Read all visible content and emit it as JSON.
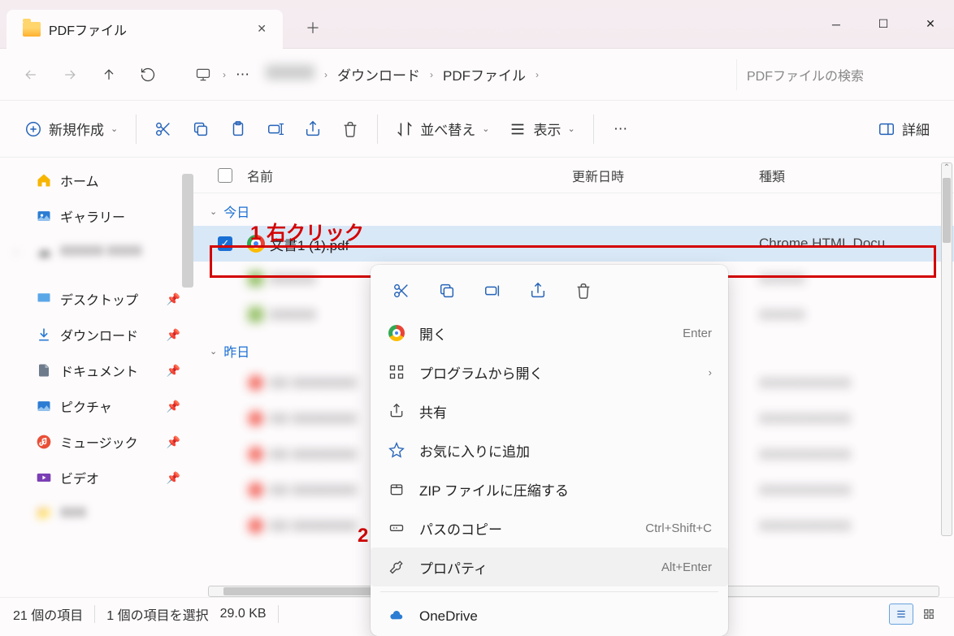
{
  "window": {
    "tab_title": "PDFファイル",
    "controls": {
      "minimize": "─",
      "maximize": "☐",
      "close": "✕"
    }
  },
  "nav": {
    "breadcrumb": {
      "item_downloads": "ダウンロード",
      "item_current": "PDFファイル"
    },
    "search_placeholder": "PDFファイルの検索"
  },
  "toolbar": {
    "new": "新規作成",
    "sort": "並べ替え",
    "view": "表示",
    "details": "詳細"
  },
  "sidebar": {
    "home": "ホーム",
    "gallery": "ギャラリー",
    "desktop": "デスクトップ",
    "downloads": "ダウンロード",
    "documents": "ドキュメント",
    "pictures": "ピクチャ",
    "music": "ミュージック",
    "videos": "ビデオ"
  },
  "columns": {
    "name": "名前",
    "date": "更新日時",
    "type": "種類"
  },
  "groups": {
    "today": "今日",
    "yesterday": "昨日"
  },
  "selected_file": {
    "name": "文書1 (1).pdf",
    "type": "Chrome HTML Docu..."
  },
  "context_menu": {
    "open": "開く",
    "open_with": "プログラムから開く",
    "share": "共有",
    "favorite": "お気に入りに追加",
    "zip": "ZIP ファイルに圧縮する",
    "copy_path": "パスのコピー",
    "properties": "プロパティ",
    "onedrive": "OneDrive",
    "shortcut_open": "Enter",
    "shortcut_copypath": "Ctrl+Shift+C",
    "shortcut_properties": "Alt+Enter"
  },
  "annotations": {
    "step1": "1 右クリック",
    "step2": "2"
  },
  "status": {
    "items": "21 個の項目",
    "selected": "1 個の項目を選択",
    "size": "29.0 KB"
  }
}
